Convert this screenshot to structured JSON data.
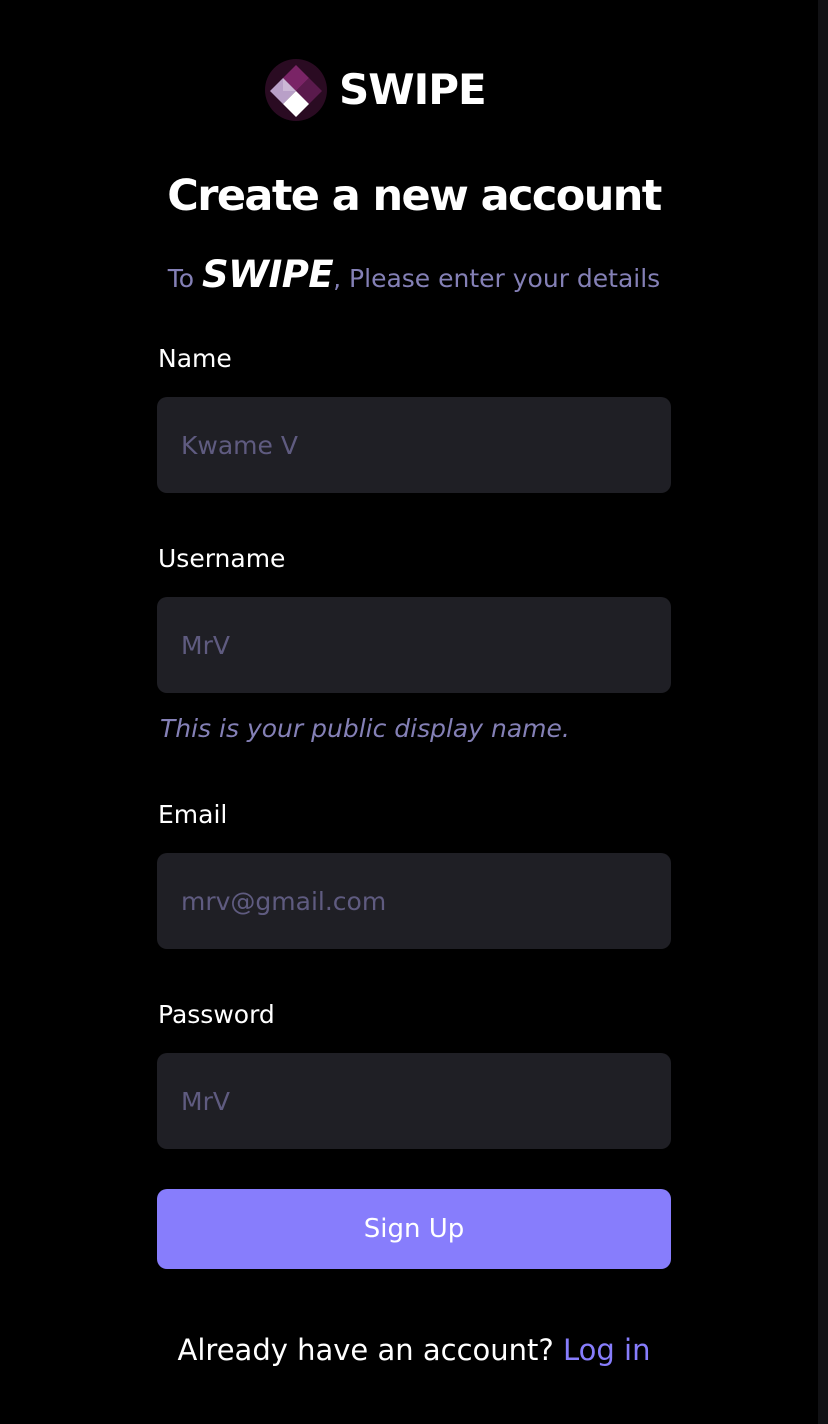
{
  "brand": {
    "name": "SWIPE",
    "logo_icon": "swipe-diamond-logo",
    "logo_colors": [
      "#3a0f2c",
      "#6b1e58",
      "#a88bb5",
      "#ffffff"
    ]
  },
  "heading": {
    "title": "Create a new account",
    "subtitle_prefix": "To ",
    "subtitle_brand": "SWIPE",
    "subtitle_suffix": ", Please enter your details"
  },
  "form": {
    "name": {
      "label": "Name",
      "placeholder": "Kwame V"
    },
    "username": {
      "label": "Username",
      "placeholder": "MrV",
      "hint": "This is your public display name."
    },
    "email": {
      "label": "Email",
      "placeholder": "mrv@gmail.com"
    },
    "password": {
      "label": "Password",
      "placeholder": "MrV"
    },
    "submit_label": "Sign Up"
  },
  "footer": {
    "prompt": "Already have an account?",
    "link_label": "Log in"
  },
  "colors": {
    "background": "#000000",
    "input_bg": "#1f1f25",
    "placeholder": "#5f5b80",
    "muted_text": "#8480b6",
    "accent": "#877dfc"
  }
}
